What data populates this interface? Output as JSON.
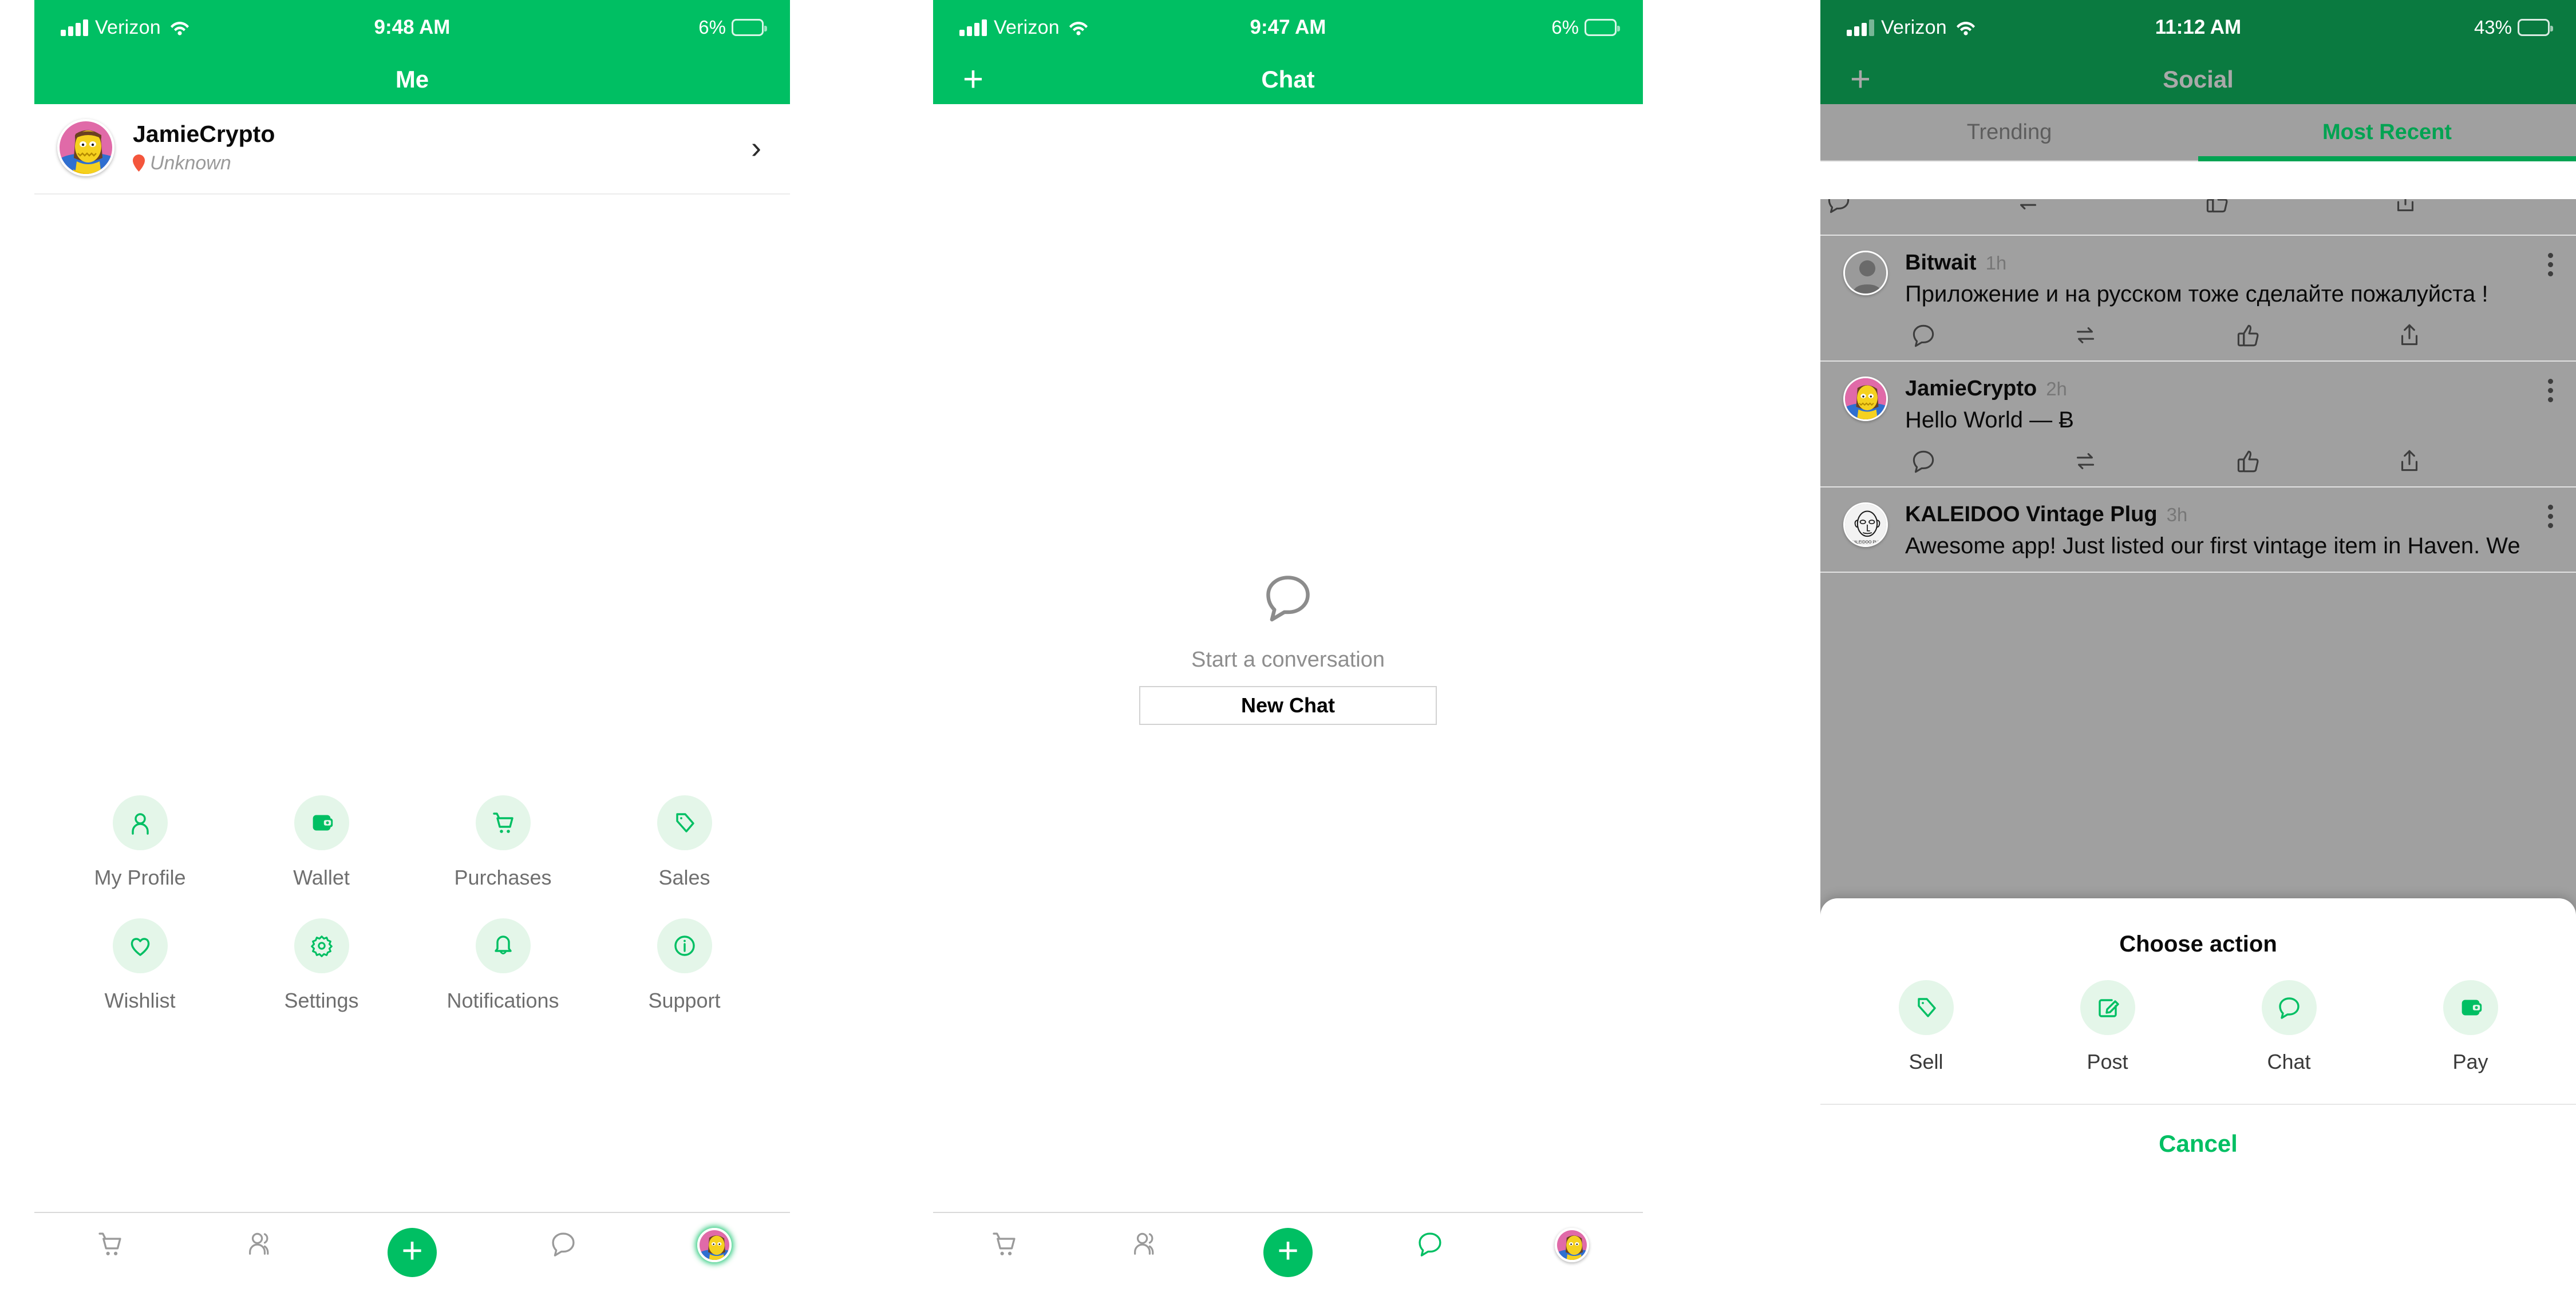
{
  "theme": {
    "brand_green": "#00bf63",
    "brand_green_dim": "#0a7a40",
    "bubble_bg": "#e4f6e9",
    "battery_yellow": "#ffcc00",
    "accent_tab_green": "#00a352",
    "muted_text": "#6f6f6f"
  },
  "panels": {
    "me": {
      "status": {
        "carrier": "Verizon",
        "time": "9:48 AM",
        "battery": "6%",
        "battery_level_pct": 14
      },
      "nav": {
        "title": "Me"
      },
      "profile": {
        "name": "JamieCrypto",
        "location": "Unknown",
        "chevron": "›"
      },
      "grid": [
        [
          {
            "label": "My Profile",
            "icon": "person-icon"
          },
          {
            "label": "Wallet",
            "icon": "wallet-icon"
          },
          {
            "label": "Purchases",
            "icon": "cart-icon"
          },
          {
            "label": "Sales",
            "icon": "tag-icon"
          }
        ],
        [
          {
            "label": "Wishlist",
            "icon": "heart-icon"
          },
          {
            "label": "Settings",
            "icon": "gear-icon"
          },
          {
            "label": "Notifications",
            "icon": "bell-icon"
          },
          {
            "label": "Support",
            "icon": "info-icon"
          }
        ]
      ],
      "tabbar": [
        {
          "name": "cart-tab",
          "icon": "cart-icon"
        },
        {
          "name": "people-tab",
          "icon": "people-icon"
        },
        {
          "name": "create-tab",
          "icon": "plus-icon",
          "label": "+"
        },
        {
          "name": "chat-tab",
          "icon": "chat-bubble-icon"
        },
        {
          "name": "me-tab",
          "icon": "avatar-icon"
        }
      ]
    },
    "chat": {
      "status": {
        "carrier": "Verizon",
        "time": "9:47 AM",
        "battery": "6%",
        "battery_level_pct": 14
      },
      "nav": {
        "title": "Chat",
        "plus": "+"
      },
      "empty": {
        "icon": "chat-bubble-icon",
        "title": "Start a conversation",
        "button_label": "New Chat"
      },
      "tabbar": [
        {
          "name": "cart-tab",
          "icon": "cart-icon"
        },
        {
          "name": "people-tab",
          "icon": "people-icon"
        },
        {
          "name": "create-tab",
          "icon": "plus-icon",
          "label": "+"
        },
        {
          "name": "chat-tab",
          "icon": "chat-bubble-icon"
        },
        {
          "name": "me-tab",
          "icon": "avatar-icon"
        }
      ]
    },
    "social": {
      "status": {
        "carrier": "Verizon",
        "time": "11:12 AM",
        "battery": "43%",
        "battery_level_pct": 43
      },
      "nav": {
        "title": "Social",
        "plus": "+"
      },
      "tabs": [
        {
          "label": "Trending",
          "active": false
        },
        {
          "label": "Most Recent",
          "active": true
        }
      ],
      "posts": [
        {
          "user": "Bitwait",
          "time": "1h",
          "text": "Приложение и на русском тоже сделайте пожалуйста !",
          "avatar": "default-person-avatar"
        },
        {
          "user": "JamieCrypto",
          "time": "2h",
          "text": "Hello World — Ƀ",
          "avatar": "jamiecrypto-avatar"
        },
        {
          "user": "KALEIDOO Vintage Plug",
          "time": "3h",
          "text": "Awesome app! Just listed our first vintage item in Haven. We",
          "avatar": "kaleidoo-plug-avatar"
        }
      ],
      "post_actions": [
        {
          "name": "comment-action",
          "icon": "chat-bubble-icon"
        },
        {
          "name": "repost-action",
          "icon": "repeat-icon"
        },
        {
          "name": "like-action",
          "icon": "thumbs-up-icon"
        },
        {
          "name": "share-action",
          "icon": "share-up-icon"
        }
      ],
      "sheet": {
        "title": "Choose action",
        "actions": [
          {
            "label": "Sell",
            "icon": "tag-icon"
          },
          {
            "label": "Post",
            "icon": "compose-icon"
          },
          {
            "label": "Chat",
            "icon": "chat-bubble-icon"
          },
          {
            "label": "Pay",
            "icon": "wallet-icon"
          }
        ],
        "cancel_label": "Cancel"
      }
    }
  }
}
